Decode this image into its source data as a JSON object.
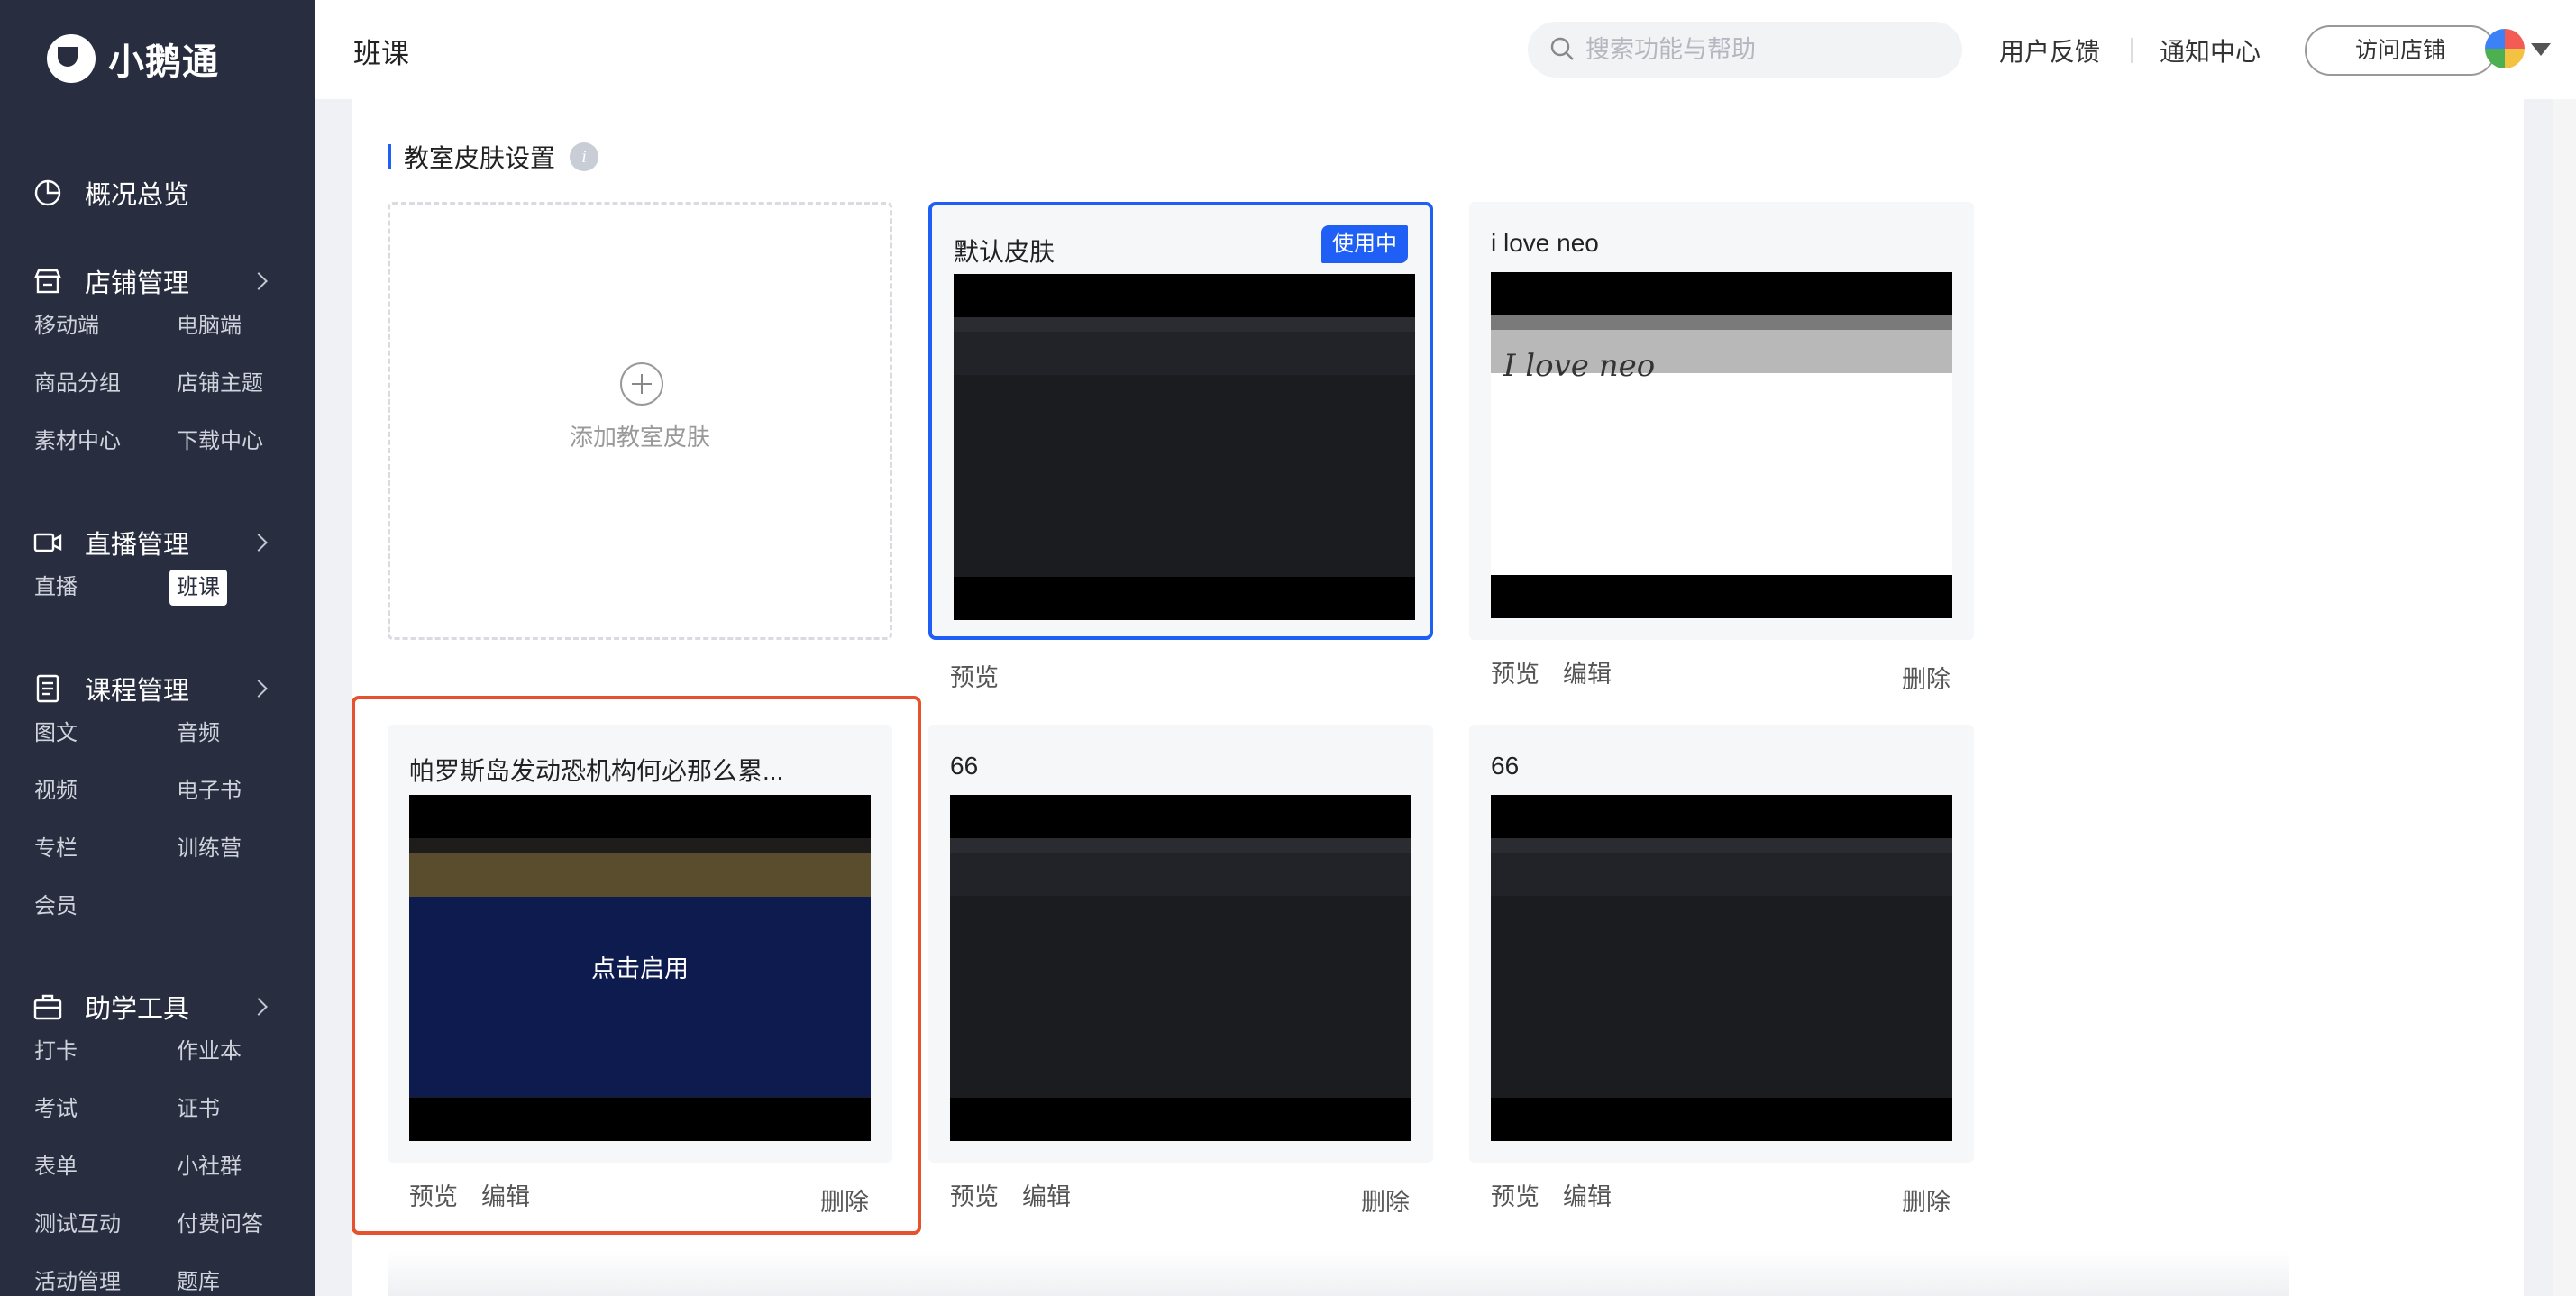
{
  "brand": {
    "name": "小鹅通"
  },
  "sidebar": {
    "groups": [
      {
        "label": "概况总览",
        "icon": "chart-pie-icon",
        "items": []
      },
      {
        "label": "店铺管理",
        "icon": "store-icon",
        "items": [
          "移动端",
          "电脑端",
          "商品分组",
          "店铺主题",
          "素材中心",
          "下载中心"
        ]
      },
      {
        "label": "直播管理",
        "icon": "video-camera-icon",
        "items": [
          "直播",
          "班课"
        ]
      },
      {
        "label": "课程管理",
        "icon": "book-icon",
        "items": [
          "图文",
          "音频",
          "视频",
          "电子书",
          "专栏",
          "训练营",
          "会员"
        ]
      },
      {
        "label": "助学工具",
        "icon": "toolbox-icon",
        "items": [
          "打卡",
          "作业本",
          "考试",
          "证书",
          "表单",
          "小社群",
          "测试互动",
          "付费问答",
          "活动管理",
          "题库"
        ]
      }
    ],
    "active_item": "班课"
  },
  "header": {
    "title": "班课",
    "search_placeholder": "搜索功能与帮助",
    "links": [
      "用户反馈",
      "通知中心"
    ],
    "visit_button": "访问店铺"
  },
  "section": {
    "title": "教室皮肤设置"
  },
  "add_card": {
    "label": "添加教室皮肤"
  },
  "skins": [
    {
      "title": "默认皮肤",
      "badge": "使用中",
      "actions": [
        "预览"
      ],
      "overlay": ""
    },
    {
      "title": "i love neo",
      "thumb_text": "I love neo",
      "actions": [
        "预览",
        "编辑"
      ],
      "delete": "删除",
      "overlay": ""
    },
    {
      "title": "帕罗斯岛发动恐机构何必那么累...",
      "actions": [
        "预览",
        "编辑"
      ],
      "delete": "删除",
      "overlay": "点击启用"
    },
    {
      "title": "66",
      "actions": [
        "预览",
        "编辑"
      ],
      "delete": "删除",
      "overlay": ""
    },
    {
      "title": "66",
      "actions": [
        "预览",
        "编辑"
      ],
      "delete": "删除",
      "overlay": ""
    }
  ],
  "colors": {
    "sidebar_bg": "#282d3f",
    "accent": "#1f5ff5",
    "highlight": "#e5522d"
  }
}
